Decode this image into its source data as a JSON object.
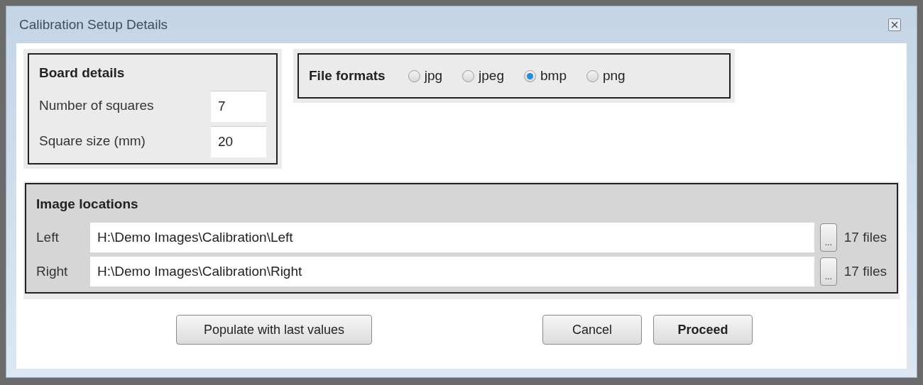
{
  "window": {
    "title": "Calibration Setup Details"
  },
  "board_details": {
    "title": "Board details",
    "fields": [
      {
        "label": "Number of squares",
        "value": "7"
      },
      {
        "label": "Square size (mm)",
        "value": "20"
      }
    ]
  },
  "file_formats": {
    "title": "File formats",
    "options": [
      {
        "label": "jpg",
        "selected": false
      },
      {
        "label": "jpeg",
        "selected": false
      },
      {
        "label": "bmp",
        "selected": true
      },
      {
        "label": "png",
        "selected": false
      }
    ]
  },
  "image_locations": {
    "title": "Image locations",
    "rows": [
      {
        "label": "Left",
        "path": "H:\\Demo Images\\Calibration\\Left",
        "browse": "...",
        "count": "17 files"
      },
      {
        "label": "Right",
        "path": "H:\\Demo Images\\Calibration\\Right",
        "browse": "...",
        "count": "17 files"
      }
    ]
  },
  "buttons": [
    {
      "label": "Populate with last values",
      "default": false
    },
    {
      "label": "Cancel",
      "default": false
    },
    {
      "label": "Proceed",
      "default": true
    }
  ]
}
